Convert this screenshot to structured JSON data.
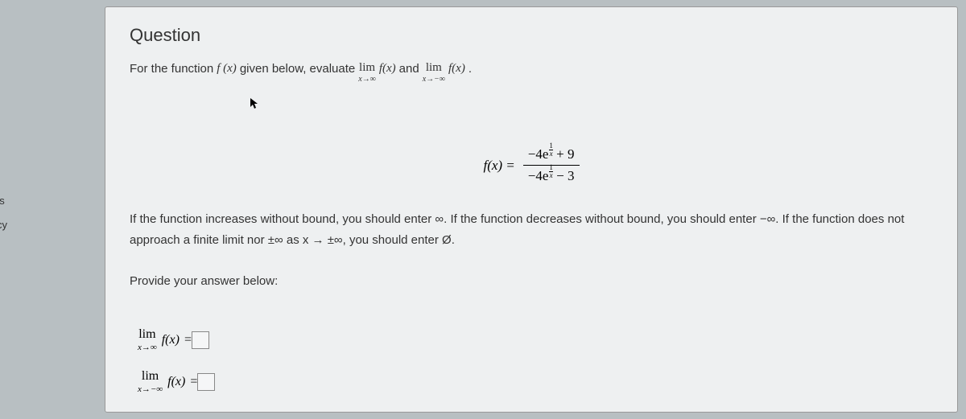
{
  "sidebar": {
    "frag1": "ns",
    "frag2": "cy"
  },
  "question": {
    "title": "Question",
    "prompt_pre": "For the function ",
    "prompt_fx": "f (x)",
    "prompt_mid": " given below, evaluate ",
    "lim_word": "lim",
    "lim_sub_pos": "x→∞",
    "lim_sub_neg": "x→−∞",
    "lim_fx": "f(x)",
    "prompt_and": " and  ",
    "prompt_period": ".",
    "formula_lhs": "f(x) =",
    "formula_num_a": "−4e",
    "formula_exp_num": "1",
    "formula_exp_den": "x",
    "formula_num_b": " + 9",
    "formula_den_b": " − 3",
    "instruction": "If the function increases without bound, you should enter ∞. If the function decreases without bound, you should enter −∞. If the function does not approach a finite limit nor ±∞ as x → ±∞, you should enter Ø.",
    "provide": "Provide your answer below:",
    "answer_eq": " = "
  }
}
